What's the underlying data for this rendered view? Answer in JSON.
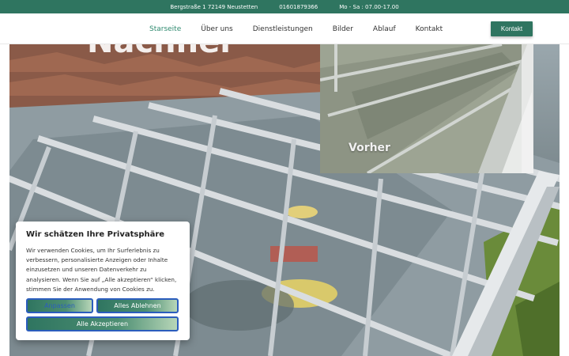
{
  "topbar": {
    "address": "Bergstraße 1 72149 Neustetten",
    "phone": "01601879366",
    "hours": "Mo - Sa : 07.00-17.00"
  },
  "nav": {
    "items": [
      {
        "label": "Starseite",
        "active": true
      },
      {
        "label": "Über uns"
      },
      {
        "label": "Dienstleistungen"
      },
      {
        "label": "Bilder"
      },
      {
        "label": "Ablauf"
      },
      {
        "label": "Kontakt"
      }
    ],
    "cta_label": "Kontakt"
  },
  "hero": {
    "overlay_text": "Nachher",
    "inset_label": "Vorher"
  },
  "cookie": {
    "title": "Wir schätzen Ihre Privatsphäre",
    "body": "Wir verwenden Cookies, um Ihr Surferlebnis zu verbessern, personalisierte Anzeigen oder Inhalte einzusetzen und unseren Datenverkehr zu analysieren. Wenn Sie auf „Alle akzeptieren“ klicken, stimmen Sie der Anwendung von Cookies zu.",
    "settings_label": "Anpassen",
    "reject_label": "Alles Ablehnen",
    "accept_label": "Alle Akzeptieren"
  },
  "colors": {
    "brand": "#2f7560",
    "accent_link": "#2f8a6f",
    "button_border": "#2b5dbd"
  }
}
